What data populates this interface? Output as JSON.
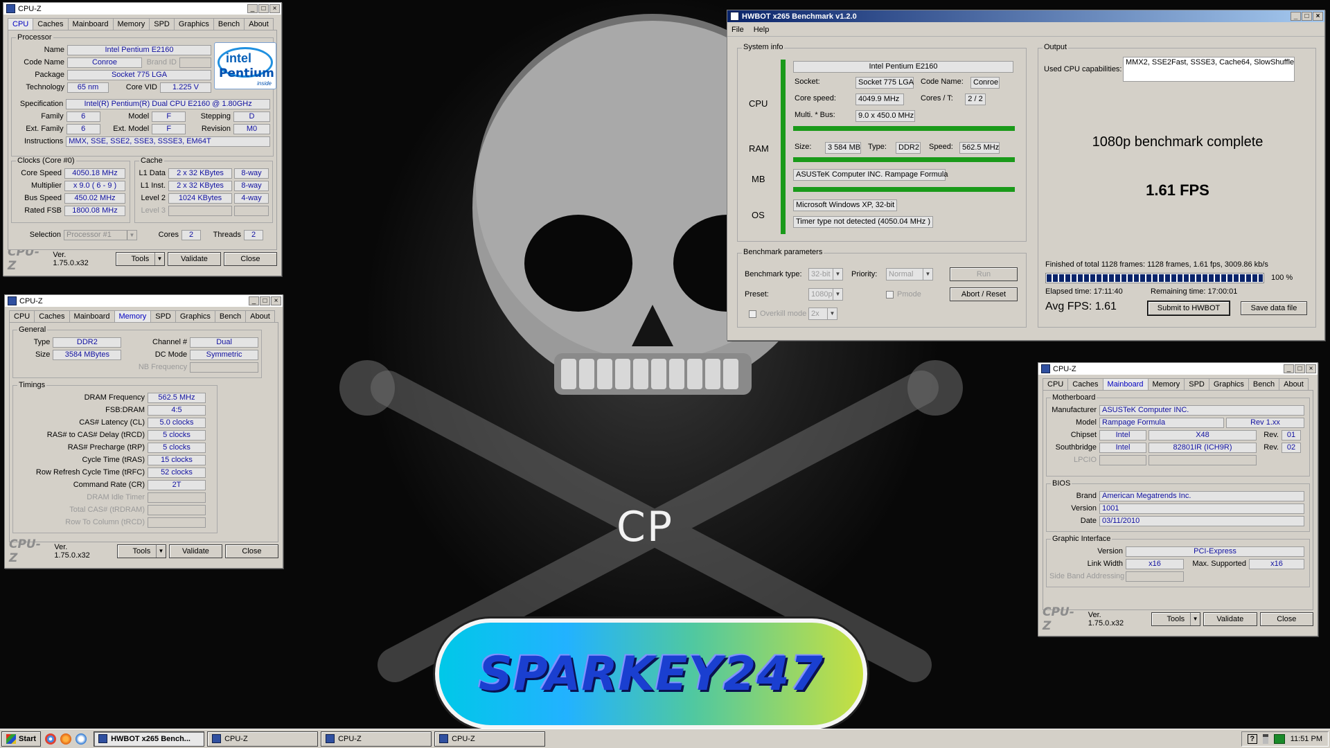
{
  "cpuz1": {
    "title": "CPU-Z",
    "tabs": [
      "CPU",
      "Caches",
      "Mainboard",
      "Memory",
      "SPD",
      "Graphics",
      "Bench",
      "About"
    ],
    "processor_label": "Processor",
    "name_label": "Name",
    "name": "Intel Pentium E2160",
    "codename_label": "Code Name",
    "codename": "Conroe",
    "brandid_label": "Brand ID",
    "package_label": "Package",
    "package": "Socket 775 LGA",
    "technology_label": "Technology",
    "technology": "65 nm",
    "corevid_label": "Core VID",
    "corevid": "1.225 V",
    "spec_label": "Specification",
    "spec": "Intel(R) Pentium(R) Dual  CPU  E2160  @ 1.80GHz",
    "family_label": "Family",
    "family": "6",
    "model_label": "Model",
    "model": "F",
    "stepping_label": "Stepping",
    "stepping": "D",
    "extfamily_label": "Ext. Family",
    "extfamily": "6",
    "extmodel_label": "Ext. Model",
    "extmodel": "F",
    "revision_label": "Revision",
    "revision": "M0",
    "instructions_label": "Instructions",
    "instructions": "MMX, SSE, SSE2, SSE3, SSSE3, EM64T",
    "clocks_label": "Clocks (Core #0)",
    "corespeed_label": "Core Speed",
    "corespeed": "4050.18 MHz",
    "multiplier_label": "Multiplier",
    "multiplier": "x 9.0 ( 6 - 9 )",
    "busspeed_label": "Bus Speed",
    "busspeed": "450.02 MHz",
    "ratedfsb_label": "Rated FSB",
    "ratedfsb": "1800.08 MHz",
    "cache_label": "Cache",
    "l1data_label": "L1 Data",
    "l1data": "2 x 32 KBytes",
    "l1data_way": "8-way",
    "l1inst_label": "L1 Inst.",
    "l1inst": "2 x 32 KBytes",
    "l1inst_way": "8-way",
    "level2_label": "Level 2",
    "level2": "1024 KBytes",
    "level2_way": "4-way",
    "level3_label": "Level 3",
    "selection_label": "Selection",
    "selection": "Processor #1",
    "cores_label": "Cores",
    "cores": "2",
    "threads_label": "Threads",
    "threads": "2",
    "logo": "CPU-Z",
    "version": "Ver. 1.75.0.x32",
    "tools": "Tools",
    "validate": "Validate",
    "close": "Close",
    "intel_brand": "intel",
    "intel_product": "Pentium",
    "intel_inside": "inside"
  },
  "cpuz2": {
    "title": "CPU-Z",
    "tabs": [
      "CPU",
      "Caches",
      "Mainboard",
      "Memory",
      "SPD",
      "Graphics",
      "Bench",
      "About"
    ],
    "general_label": "General",
    "type_label": "Type",
    "type": "DDR2",
    "channel_label": "Channel #",
    "channel": "Dual",
    "size_label": "Size",
    "size": "3584 MBytes",
    "dcmode_label": "DC Mode",
    "dcmode": "Symmetric",
    "nbfreq_label": "NB Frequency",
    "timings_label": "Timings",
    "timings": [
      {
        "label": "DRAM Frequency",
        "value": "562.5 MHz",
        "dim": false
      },
      {
        "label": "FSB:DRAM",
        "value": "4:5",
        "dim": false
      },
      {
        "label": "CAS# Latency (CL)",
        "value": "5.0 clocks",
        "dim": false
      },
      {
        "label": "RAS# to CAS# Delay (tRCD)",
        "value": "5 clocks",
        "dim": false
      },
      {
        "label": "RAS# Precharge (tRP)",
        "value": "5 clocks",
        "dim": false
      },
      {
        "label": "Cycle Time (tRAS)",
        "value": "15 clocks",
        "dim": false
      },
      {
        "label": "Row Refresh Cycle Time (tRFC)",
        "value": "52 clocks",
        "dim": false
      },
      {
        "label": "Command Rate (CR)",
        "value": "2T",
        "dim": false
      },
      {
        "label": "DRAM Idle Timer",
        "value": "",
        "dim": true
      },
      {
        "label": "Total CAS# (tRDRAM)",
        "value": "",
        "dim": true
      },
      {
        "label": "Row To Column (tRCD)",
        "value": "",
        "dim": true
      }
    ],
    "logo": "CPU-Z",
    "version": "Ver. 1.75.0.x32",
    "tools": "Tools",
    "validate": "Validate",
    "close": "Close"
  },
  "cpuz3": {
    "title": "CPU-Z",
    "tabs": [
      "CPU",
      "Caches",
      "Mainboard",
      "Memory",
      "SPD",
      "Graphics",
      "Bench",
      "About"
    ],
    "motherboard_label": "Motherboard",
    "manufacturer_label": "Manufacturer",
    "manufacturer": "ASUSTeK Computer INC.",
    "model_label": "Model",
    "model": "Rampage Formula",
    "model_rev": "Rev 1.xx",
    "chipset_label": "Chipset",
    "chipset_vendor": "Intel",
    "chipset": "X48",
    "chipset_rev_label": "Rev.",
    "chipset_rev": "01",
    "southbridge_label": "Southbridge",
    "sb_vendor": "Intel",
    "sb": "82801IR (ICH9R)",
    "sb_rev_label": "Rev.",
    "sb_rev": "02",
    "lpcio_label": "LPCIO",
    "bios_label": "BIOS",
    "brand_label": "Brand",
    "brand": "American Megatrends Inc.",
    "version_label": "Version",
    "bios_version": "1001",
    "date_label": "Date",
    "date": "03/11/2010",
    "gi_label": "Graphic Interface",
    "giversion_label": "Version",
    "giversion": "PCI-Express",
    "linkwidth_label": "Link Width",
    "linkwidth": "x16",
    "maxsup_label": "Max. Supported",
    "maxsup": "x16",
    "sideband_label": "Side Band Addressing",
    "logo": "CPU-Z",
    "version": "Ver. 1.75.0.x32",
    "tools": "Tools",
    "validate": "Validate",
    "close": "Close"
  },
  "hwbot": {
    "title": "HWBOT x265 Benchmark v1.2.0",
    "menu_file": "File",
    "menu_help": "Help",
    "sysinfo_label": "System info",
    "cpu_label": "CPU",
    "ram_label": "RAM",
    "mb_label": "MB",
    "os_label": "OS",
    "cpu_name": "Intel Pentium E2160",
    "socket_label": "Socket:",
    "socket": "Socket 775 LGA",
    "codename_label": "Code Name:",
    "codename": "Conroe",
    "corespeed_label": "Core speed:",
    "corespeed": "4049.9 MHz",
    "corest_label": "Cores / T:",
    "corest": "2 / 2",
    "multibus_label": "Multi. * Bus:",
    "multibus": "9.0 x 450.0 MHz",
    "size_label": "Size:",
    "size": "3 584 MB",
    "type_label": "Type:",
    "type": "DDR2",
    "speed_label": "Speed:",
    "speed": "562.5 MHz",
    "mb": "ASUSTeK Computer INC. Rampage Formula",
    "os": "Microsoft Windows XP, 32-bit",
    "timer": "Timer type not detected (4050.04 MHz )",
    "params_label": "Benchmark parameters",
    "benchtype_label": "Benchmark type:",
    "benchtype": "32-bit",
    "priority_label": "Priority:",
    "priority": "Normal",
    "run": "Run",
    "preset_label": "Preset:",
    "preset": "1080p",
    "pmode_label": "Pmode",
    "abort": "Abort / Reset",
    "overkill_label": "Overkill mode",
    "overkill": "2x",
    "output_label": "Output",
    "usedcpu_label": "Used CPU capabilities:",
    "usedcpu": "MMX2, SSE2Fast, SSSE3, Cache64, SlowShuffle",
    "complete": "1080p benchmark complete",
    "fps": "1.61 FPS",
    "finished": "Finished of total 1128 frames: 1128 frames, 1.61 fps,  3009.86 kb/s",
    "progress_pct": "100 %",
    "progress_value": 1.0,
    "elapsed": "Elapsed time: 17:11:40",
    "remaining": "Remaining time: 17:00:01",
    "avgfps": "Avg FPS: 1.61",
    "submit": "Submit to HWBOT",
    "save": "Save data file"
  },
  "desktop": {
    "cp_text": "CP",
    "logo_text": "SPARKEY247"
  },
  "taskbar": {
    "start": "Start",
    "tasks": [
      "HWBOT x265 Bench...",
      "CPU-Z",
      "CPU-Z",
      "CPU-Z"
    ],
    "clock": "11:51 PM",
    "help_glyph": "?"
  }
}
